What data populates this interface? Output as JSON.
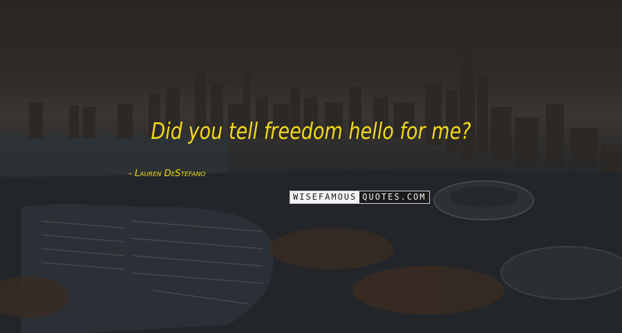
{
  "quote": {
    "text": "Did you tell freedom hello for me?",
    "author": "- Lauren DeStefano"
  },
  "watermark": {
    "left": "WISEFAMOUS",
    "right": "QUOTES.COM"
  },
  "colors": {
    "quote_text": "#f2d91c",
    "overlay": "#1c1a18"
  }
}
